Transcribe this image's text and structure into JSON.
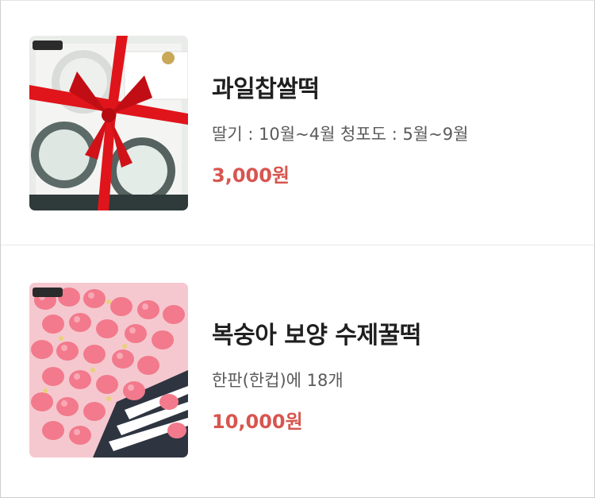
{
  "products": [
    {
      "title": "과일찹쌀떡",
      "description": "딸기 : 10월~4월 청포도 : 5월~9월",
      "price": "3,000원"
    },
    {
      "title": "복숭아 보양 수제꿀떡",
      "description": "한판(한컵)에 18개",
      "price": "10,000원"
    }
  ],
  "colors": {
    "price": "#d8554f",
    "ribbon": "#e0151b",
    "peach": "#f27a8c"
  }
}
